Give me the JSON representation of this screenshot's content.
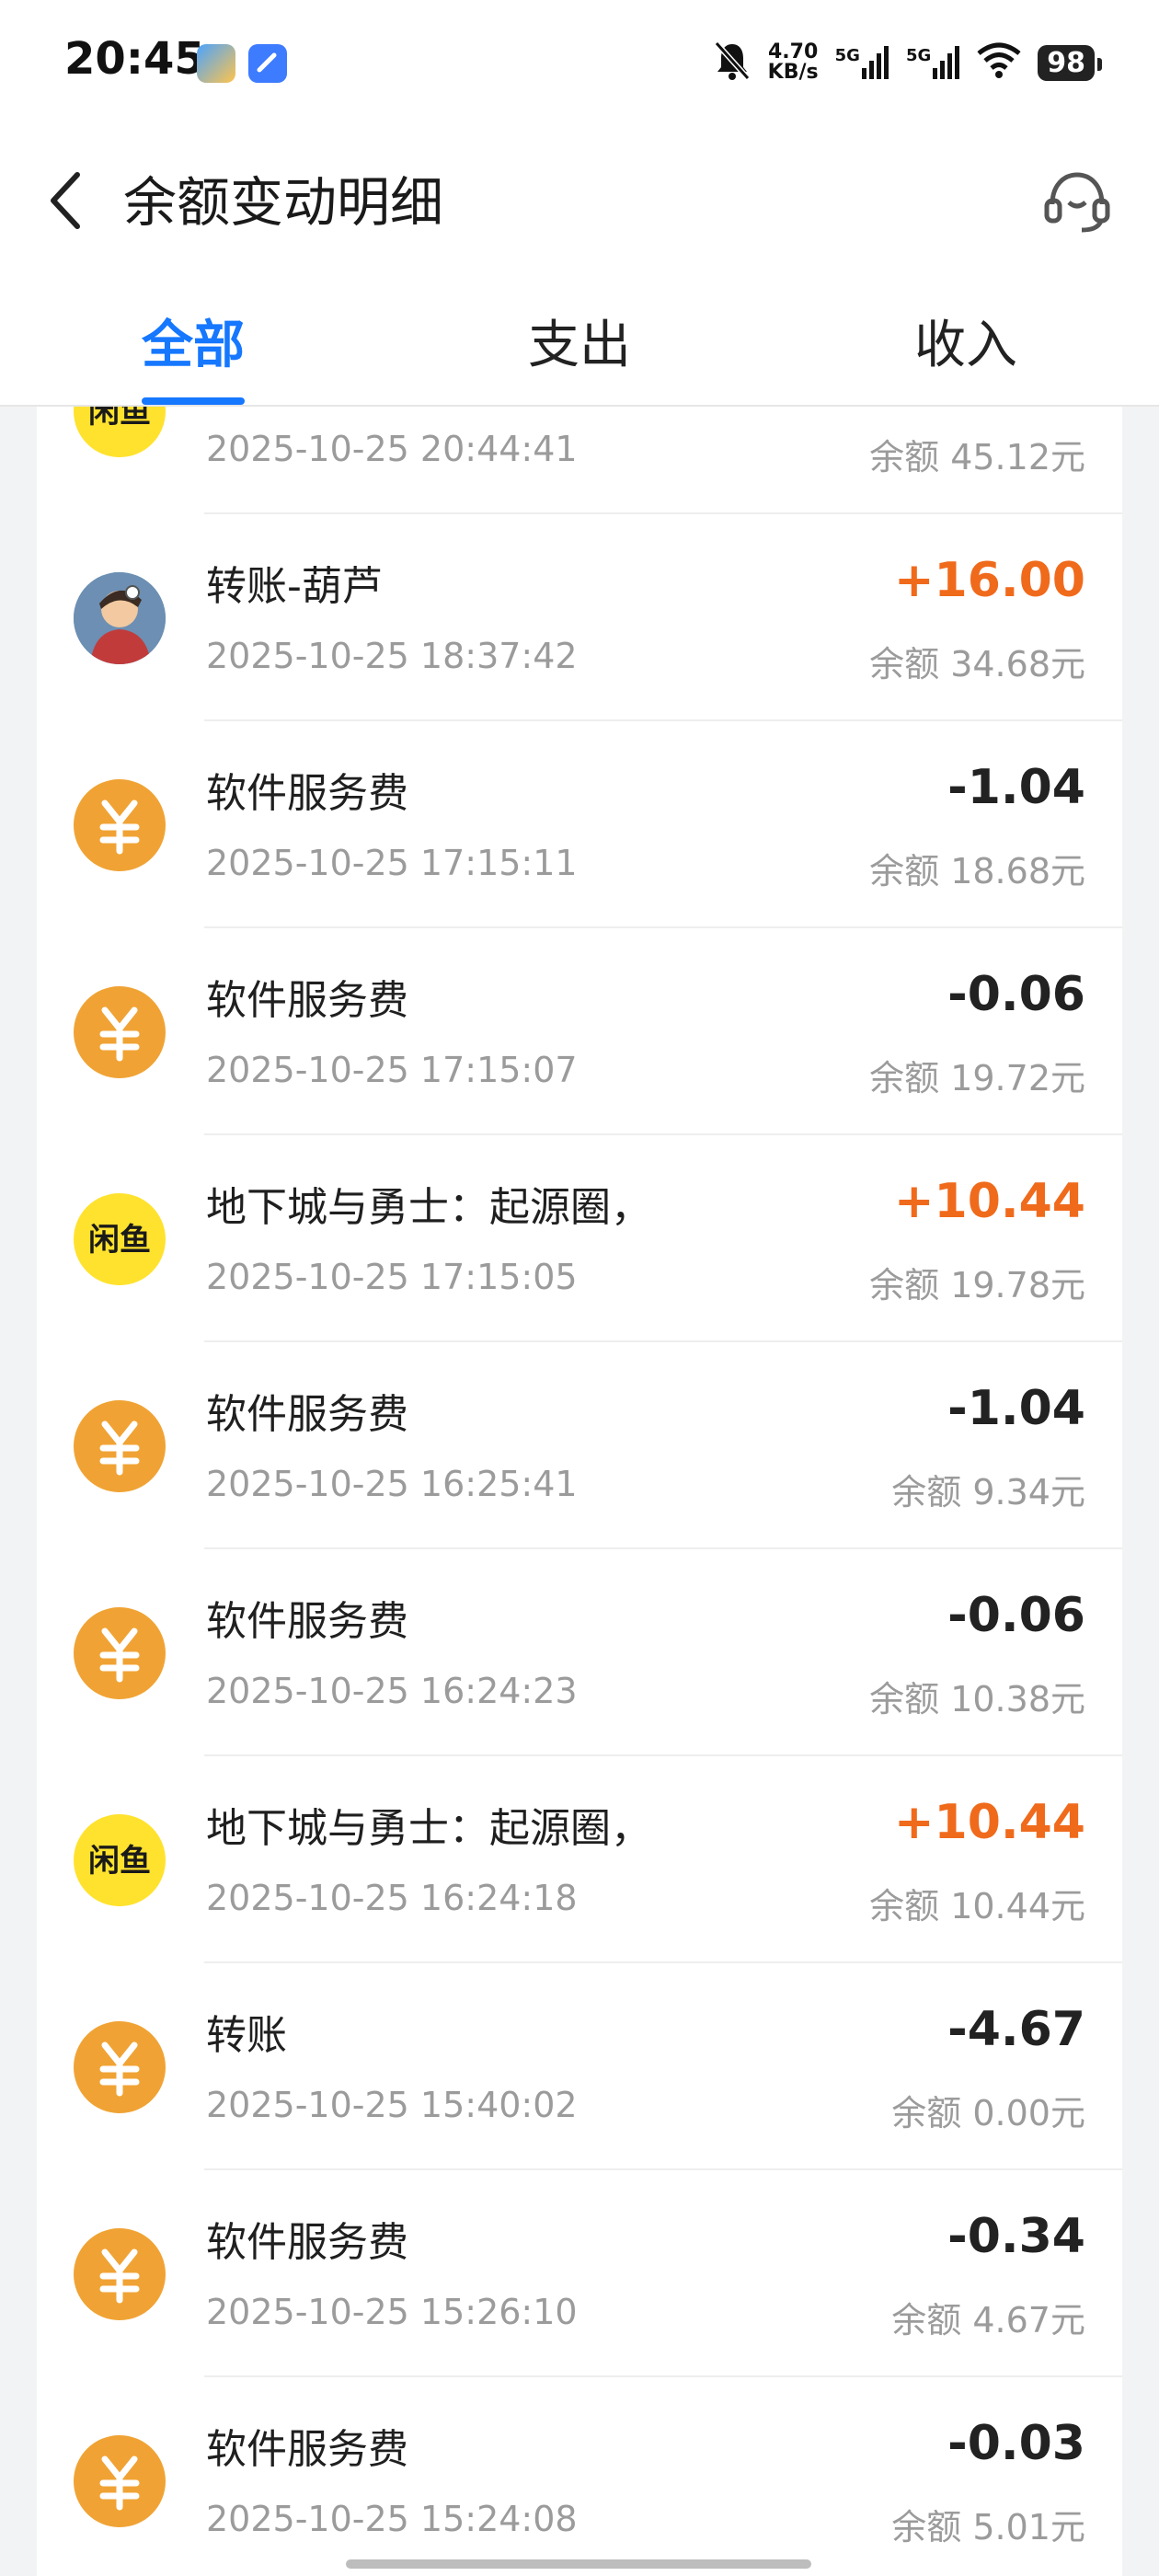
{
  "status_bar": {
    "time": "20:45",
    "net_speed_value": "4.70",
    "net_speed_unit": "KB/s",
    "sim1": "5G",
    "sim2": "5G",
    "battery": "98"
  },
  "header": {
    "title": "余额变动明细",
    "back_icon": "chevron-left-icon",
    "service_icon": "headset-icon"
  },
  "tabs": [
    {
      "label": "全部",
      "active": true
    },
    {
      "label": "支出",
      "active": false
    },
    {
      "label": "收入",
      "active": false
    }
  ],
  "transactions": [
    {
      "icon": "xianyu",
      "title": "",
      "time": "2025-10-25 20:44:41",
      "amount": "",
      "balance": "余额 45.12元"
    },
    {
      "icon": "photo",
      "title": "转账-葫芦",
      "time": "2025-10-25 18:37:42",
      "amount": "+16.00",
      "balance": "余额 34.68元"
    },
    {
      "icon": "fee",
      "title": "软件服务费",
      "time": "2025-10-25 17:15:11",
      "amount": "-1.04",
      "balance": "余额 18.68元"
    },
    {
      "icon": "fee",
      "title": "软件服务费",
      "time": "2025-10-25 17:15:07",
      "amount": "-0.06",
      "balance": "余额 19.72元"
    },
    {
      "icon": "xianyu",
      "title": "地下城与勇士：起源圈，",
      "time": "2025-10-25 17:15:05",
      "amount": "+10.44",
      "balance": "余额 19.78元"
    },
    {
      "icon": "fee",
      "title": "软件服务费",
      "time": "2025-10-25 16:25:41",
      "amount": "-1.04",
      "balance": "余额 9.34元"
    },
    {
      "icon": "fee",
      "title": "软件服务费",
      "time": "2025-10-25 16:24:23",
      "amount": "-0.06",
      "balance": "余额 10.38元"
    },
    {
      "icon": "xianyu",
      "title": "地下城与勇士：起源圈，",
      "time": "2025-10-25 16:24:18",
      "amount": "+10.44",
      "balance": "余额 10.44元"
    },
    {
      "icon": "fee",
      "title": "转账",
      "time": "2025-10-25 15:40:02",
      "amount": "-4.67",
      "balance": "余额 0.00元"
    },
    {
      "icon": "fee",
      "title": "软件服务费",
      "time": "2025-10-25 15:26:10",
      "amount": "-0.34",
      "balance": "余额 4.67元"
    },
    {
      "icon": "fee",
      "title": "软件服务费",
      "time": "2025-10-25 15:24:08",
      "amount": "-0.03",
      "balance": "余额 5.01元"
    }
  ],
  "icon_labels": {
    "xianyu": "闲鱼"
  },
  "colors": {
    "accent": "#1677ff",
    "income": "#f06a1c",
    "fee_icon": "#f0a334",
    "xianyu_icon": "#ffe22e"
  }
}
